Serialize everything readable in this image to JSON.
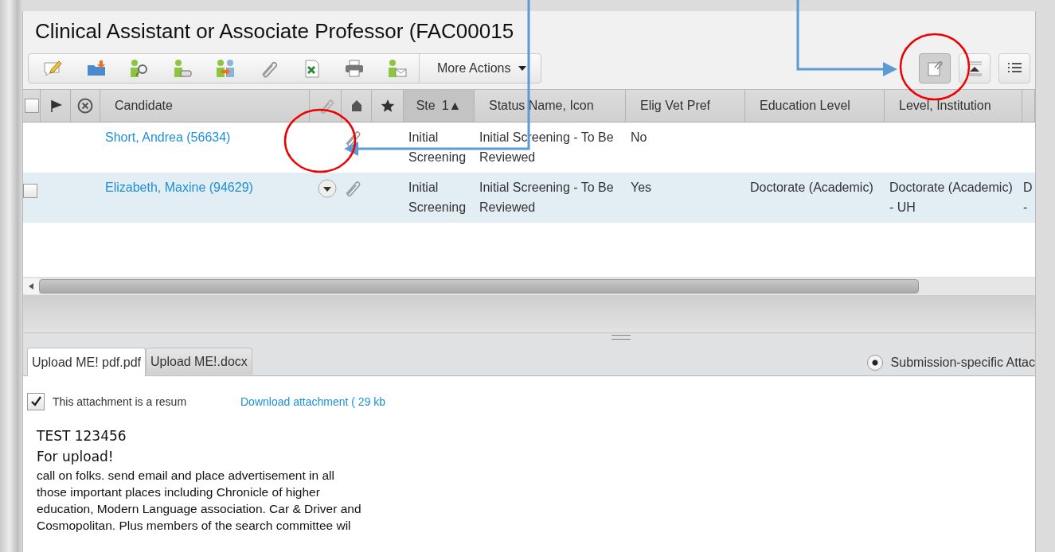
{
  "title": "Clinical Assistant or Associate Professor (FAC00015",
  "toolbar": {
    "more_actions": "More Actions"
  },
  "view_buttons": [
    {
      "kind": "attachments",
      "selected": true
    },
    {
      "kind": "collapse",
      "selected": false
    },
    {
      "kind": "list",
      "selected": false
    }
  ],
  "table": {
    "columns": [
      {
        "kind": "check",
        "checked": false
      },
      {
        "kind": "flag"
      },
      {
        "kind": "cancel"
      },
      {
        "kind": "text",
        "label": "Candidate"
      },
      {
        "kind": "attach"
      },
      {
        "kind": "home"
      },
      {
        "kind": "star"
      },
      {
        "kind": "sort",
        "label": "Ste",
        "sort": "1▲"
      },
      {
        "kind": "text",
        "label": "Status Name, Icon"
      },
      {
        "kind": "text",
        "label": "Elig Vet Pref"
      },
      {
        "kind": "text",
        "label": "Education Level"
      },
      {
        "kind": "text",
        "label": "Level, Institution"
      },
      {
        "kind": "blank"
      }
    ],
    "rows": [
      {
        "selected": false,
        "candidate": "Short, Andrea (56634)",
        "menu": false,
        "attachment": true,
        "step": "Initial Screening",
        "status": "Initial Screening - To Be Reviewed",
        "vet": "No",
        "education": "",
        "institution": "",
        "column_13": ""
      },
      {
        "selected": true,
        "checkbox": {
          "checked": false
        },
        "candidate": "Elizabeth, Maxine (94629)",
        "menu": true,
        "attachment": true,
        "step": "Initial Screening",
        "status": "Initial Screening - To Be Reviewed",
        "vet": "Yes",
        "education": "Doctorate (Academic)",
        "institution": "Doctorate (Academic) - UH",
        "column_13": "D -"
      }
    ]
  },
  "attachments": {
    "tabs": [
      {
        "label": "Upload ME! pdf.pdf",
        "selected": true
      },
      {
        "label": "Upload ME!.docx",
        "selected": false
      }
    ],
    "scope": {
      "label": "Submission-specific Attac",
      "selected": true
    },
    "resume": {
      "label": "This attachment is a resum",
      "checked": true
    },
    "download": "Download attachment ( 29 kb",
    "document": {
      "heading": "TEST 123456",
      "subheading": "For upload!",
      "lines": [
        "call on folks. send email and place advertisement in all",
        "those important places including Chronicle of higher",
        "education, Modern Language association. Car & Driver and",
        "Cosmopolitan. Plus members of the search committee wil"
      ]
    }
  }
}
